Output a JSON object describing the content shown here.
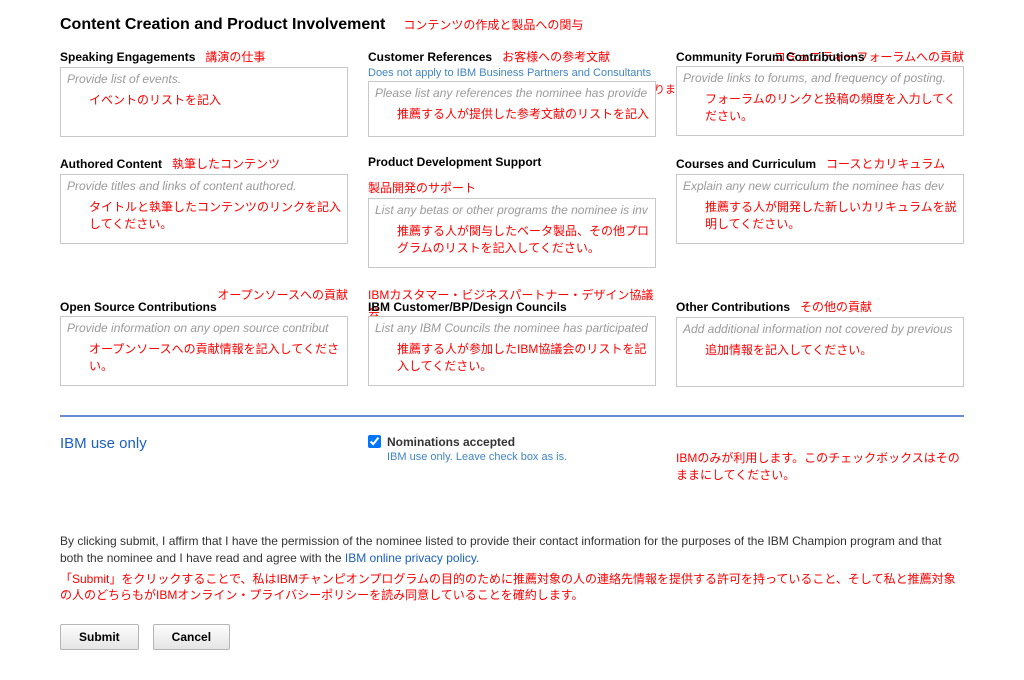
{
  "section": {
    "title": "Content Creation and Product Involvement",
    "title_jp": "コンテンツの作成と製品への関与"
  },
  "fields": {
    "speaking": {
      "label": "Speaking Engagements",
      "label_jp": "講演の仕事",
      "placeholder": "Provide list of events.",
      "inside_jp": "イベントのリストを記入"
    },
    "customer_ref": {
      "label": "Customer References",
      "label_jp": "お客様への参考文献",
      "subnote": "Does not apply to IBM Business Partners and Consultants",
      "subnote_jp": "ビジネスパートナー、コンサルタントへ宛てたものではありません。",
      "placeholder": "Please list any references the nominee has provide",
      "inside_jp": "推薦する人が提供した参考文献のリストを記入"
    },
    "community": {
      "label": "Community Forum Contributions",
      "above_jp": "コミュニティーフォーラムへの貢献",
      "placeholder": "Provide links to forums, and frequency of posting.",
      "inside_jp": "フォーラムのリンクと投稿の頻度を入力してください。"
    },
    "authored": {
      "label": "Authored Content",
      "label_jp": "執筆したコンテンツ",
      "placeholder": "Provide titles and links of content authored.",
      "inside_jp": "タイトルと執筆したコンテンツのリンクを記入してください。"
    },
    "dev_support": {
      "label": "Product Development Support",
      "label_jp": "製品開発のサポート",
      "placeholder": "List any betas or other programs the nominee is inv",
      "inside_jp": "推薦する人が関与したベータ製品、その他プログラムのリストを記入してください。"
    },
    "courses": {
      "label": "Courses and Curriculum",
      "label_jp": "コースとカリキュラム",
      "placeholder": "Explain any new curriculum the nominee has dev",
      "inside_jp": "推薦する人が開発した新しいカリキュラムを説明してください。"
    },
    "opensource": {
      "label": "Open Source Contributions",
      "above_jp": "オープンソースへの貢献",
      "placeholder": "Provide information on any open source contribut",
      "inside_jp": "オープンソースへの貢献情報を記入してください。"
    },
    "councils": {
      "label": "IBM Customer/BP/Design Councils",
      "above_jp": "IBMカスタマー・ビジネスパートナー・デザイン協議会",
      "placeholder": "List any IBM Councils the nominee has participated",
      "inside_jp": "推薦する人が参加したIBM協議会のリストを記入してください。"
    },
    "other": {
      "label": "Other Contributions",
      "label_jp": "その他の貢献",
      "placeholder": "Add additional information not covered by previous",
      "inside_jp": "追加情報を記入してください。"
    }
  },
  "ibm": {
    "title": "IBM use only",
    "nom_label": "Nominations accepted",
    "nom_sub": "IBM use only. Leave check box as is.",
    "jp": "IBMのみが利用します。このチェックボックスはそのままにしてください。"
  },
  "affirm": {
    "text_a": "By clicking submit, I affirm that I have the permission of the nominee listed to provide their contact information for the purposes of the IBM Champion program and that both the nominee and I have read and agree with the ",
    "link": "IBM online privacy policy.",
    "jp": "「Submit」をクリックすることで、私はIBMチャンピオンプログラムの目的のために推薦対象の人の連絡先情報を提供する許可を持っていること、そして私と推薦対象の人のどちらもがIBMオンライン・プライバシーポリシーを読み同意していることを確約します。"
  },
  "buttons": {
    "submit": "Submit",
    "cancel": "Cancel"
  }
}
